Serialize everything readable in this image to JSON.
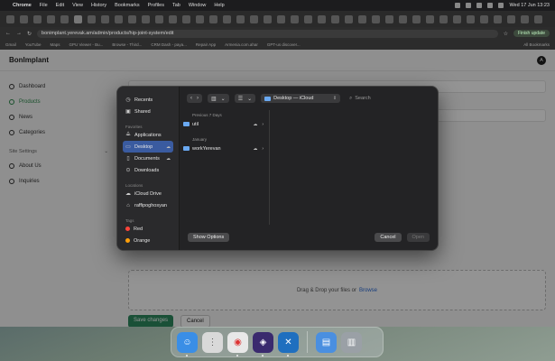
{
  "menubar": {
    "app": "Chrome",
    "items": [
      "File",
      "Edit",
      "View",
      "History",
      "Bookmarks",
      "Profiles",
      "Tab",
      "Window",
      "Help"
    ],
    "clock": "Wed 17 Jun  13:23"
  },
  "browser": {
    "url": "bonimplant.yerevak.am/admin/products/hip-joint-system/edit",
    "finish_update": "Finish update",
    "bookmarks": [
      "Gmail",
      "YouTube",
      "Maps",
      "GPU Viewer - Bu...",
      "Browse - Third...",
      "CRM Dash - paya...",
      "Repair App",
      "Armenia.com.ahar",
      "GPT-us discover..."
    ],
    "all_bookmarks": "All Bookmarks"
  },
  "app": {
    "title": "BonImplant",
    "avatar": "A",
    "nav": [
      {
        "label": "Dashboard",
        "icon": "dashboard-icon"
      },
      {
        "label": "Products",
        "icon": "products-icon"
      },
      {
        "label": "News",
        "icon": "news-icon"
      },
      {
        "label": "Categories",
        "icon": "categories-icon"
      }
    ],
    "site_settings": "Site Settings",
    "settings_nav": [
      {
        "label": "About Us",
        "icon": "info-icon"
      },
      {
        "label": "Inquiries",
        "icon": "inquiries-icon"
      }
    ],
    "dropzone_text": "Drag & Drop your files or",
    "dropzone_link": "Browse",
    "save_label": "Save changes",
    "cancel_label": "Cancel"
  },
  "dialog": {
    "favorites": [
      {
        "label": "Recents",
        "icon": "clock-icon"
      },
      {
        "label": "Shared",
        "icon": "shared-icon"
      }
    ],
    "favorites_title": "Favorites",
    "favorites_items": [
      {
        "label": "Applications",
        "icon": "applications-icon"
      },
      {
        "label": "Desktop",
        "icon": "desktop-icon"
      },
      {
        "label": "Documents",
        "icon": "documents-icon"
      },
      {
        "label": "Downloads",
        "icon": "downloads-icon"
      }
    ],
    "locations_title": "Locations",
    "locations": [
      {
        "label": "iCloud Drive",
        "icon": "icloud-icon"
      },
      {
        "label": "raffipoghosyan",
        "icon": "home-icon"
      }
    ],
    "tags_title": "Tags",
    "tags": [
      {
        "label": "Red",
        "color": "#ff453a"
      },
      {
        "label": "Orange",
        "color": "#ff9f0a"
      }
    ],
    "location": "Desktop — iCloud",
    "search_placeholder": "Search",
    "groups": [
      {
        "title": "Previous 7 Days",
        "files": [
          "util"
        ]
      },
      {
        "title": "January",
        "files": [
          "workYerevan"
        ]
      }
    ],
    "show_options": "Show Options",
    "cancel": "Cancel",
    "open": "Open"
  },
  "dock": [
    {
      "name": "finder",
      "color": "#3a8ee6",
      "glyph": "☺"
    },
    {
      "name": "launchpad",
      "color": "#d9d9d9",
      "glyph": "⋮"
    },
    {
      "name": "chrome",
      "color": "#e8e8e8",
      "glyph": "◉"
    },
    {
      "name": "app-purple",
      "color": "#3a2a6e",
      "glyph": "◈"
    },
    {
      "name": "vscode",
      "color": "#1f6fbf",
      "glyph": "✕"
    },
    {
      "name": "preview",
      "color": "#4a8fe0",
      "glyph": "▤"
    },
    {
      "name": "trash",
      "color": "#9aa0a6",
      "glyph": "▥"
    }
  ]
}
